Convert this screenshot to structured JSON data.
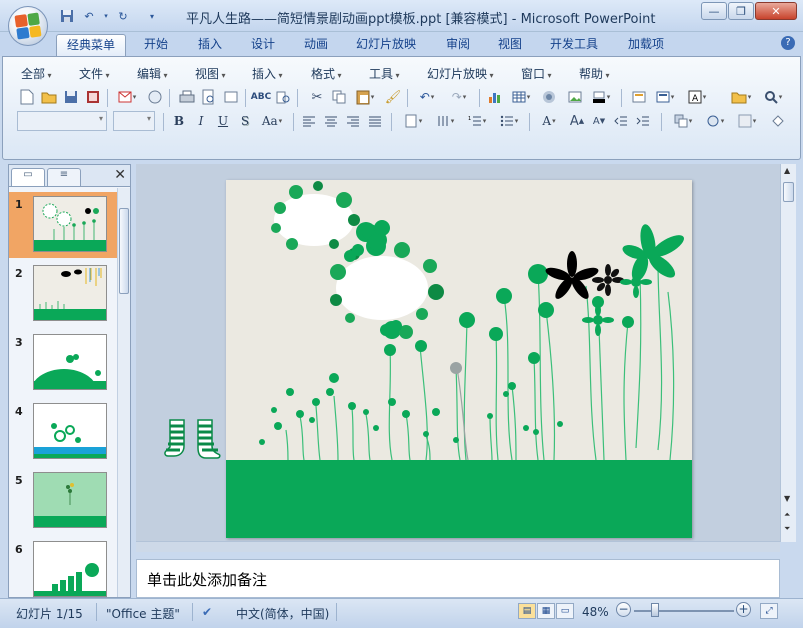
{
  "window": {
    "title": "平凡人生路——简短情景剧动画ppt模板.ppt [兼容模式] - Microsoft PowerPoint"
  },
  "ribbon_tabs": [
    {
      "label": "经典菜单",
      "active": true
    },
    {
      "label": "开始"
    },
    {
      "label": "插入"
    },
    {
      "label": "设计"
    },
    {
      "label": "动画"
    },
    {
      "label": "幻灯片放映"
    },
    {
      "label": "审阅"
    },
    {
      "label": "视图"
    },
    {
      "label": "开发工具"
    },
    {
      "label": "加载项"
    }
  ],
  "classic_menu": [
    {
      "label": "全部"
    },
    {
      "label": "文件"
    },
    {
      "label": "编辑"
    },
    {
      "label": "视图"
    },
    {
      "label": "插入"
    },
    {
      "label": "格式"
    },
    {
      "label": "工具"
    },
    {
      "label": "幻灯片放映"
    },
    {
      "label": "窗口"
    },
    {
      "label": "帮助"
    }
  ],
  "toolbar": {
    "bold": "B",
    "italic": "I",
    "underline": "U",
    "shadow": "S",
    "spacing": "Aa",
    "font_color": "A"
  },
  "slides_panel": {
    "current_slide": 1,
    "thumbnails": [
      {
        "number": "1"
      },
      {
        "number": "2"
      },
      {
        "number": "3"
      },
      {
        "number": "4"
      },
      {
        "number": "5"
      },
      {
        "number": "6"
      }
    ]
  },
  "notes": {
    "placeholder": "单击此处添加备注"
  },
  "status_bar": {
    "slide_info": "幻灯片 1/15",
    "theme": "\"Office 主题\"",
    "language": "中文(简体，中国)",
    "zoom": "48%"
  },
  "colors": {
    "grass": "#0aa858",
    "slide_bg": "#ebe9e1",
    "selected_thumb": "#f1a564",
    "ribbon_text": "#15428b"
  }
}
